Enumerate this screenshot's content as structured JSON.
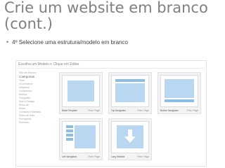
{
  "slide": {
    "title_line1": "Crie um website em branco",
    "title_line2": "(cont.)",
    "bullet": "4º Selecione uma estrutura/modelo em branco"
  },
  "dialog": {
    "title": "Escolha um Modelo e Clique em Editar",
    "sidebar": {
      "items": [
        {
          "label": "Site em Branco",
          "kind": "item"
        },
        {
          "label": "Categorias",
          "kind": "header"
        },
        {
          "label": "Todo",
          "kind": "item"
        },
        {
          "label": "eCommerce",
          "kind": "item"
        },
        {
          "label": "Negócios",
          "kind": "item"
        },
        {
          "label": "Consultoria",
          "kind": "item"
        },
        {
          "label": "Música",
          "kind": "item"
        },
        {
          "label": "Fotografia",
          "kind": "item"
        },
        {
          "label": "Arte & Design",
          "kind": "item"
        },
        {
          "label": "Show de",
          "kind": "item"
        },
        {
          "label": "Moda",
          "kind": "item"
        },
        {
          "label": "Comidas e Bebidas",
          "kind": "item"
        },
        {
          "label": "Estilo de Vida",
          "kind": "item"
        },
        {
          "label": "Portugonia",
          "kind": "item"
        },
        {
          "label": "Diversos",
          "kind": "item"
        }
      ]
    },
    "templates": [
      {
        "name": "Blank Template",
        "price": "Price: Page"
      },
      {
        "name": "Top Navigation",
        "price": "Price: Page"
      },
      {
        "name": "Bottom Navigation",
        "price": "Price: Page"
      },
      {
        "name": "Left Navigation",
        "price": "Price: Page"
      },
      {
        "name": "Long Website",
        "price": "Price: Page"
      }
    ]
  }
}
